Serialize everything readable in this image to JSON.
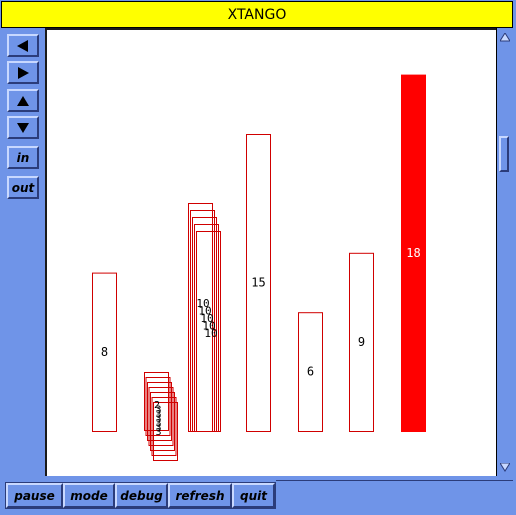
{
  "window": {
    "title": "XTANGO"
  },
  "nav_buttons": [
    {
      "name": "pan-left-button",
      "icon": "arrow-left-icon"
    },
    {
      "name": "pan-right-button",
      "icon": "arrow-right-icon"
    },
    {
      "name": "pan-up-button",
      "icon": "arrow-up-icon"
    },
    {
      "name": "pan-down-button",
      "icon": "arrow-down-icon"
    },
    {
      "name": "zoom-in-button",
      "label": "in"
    },
    {
      "name": "zoom-out-button",
      "label": "out"
    }
  ],
  "controls": [
    "pause",
    "mode",
    "debug",
    "refresh",
    "quit"
  ],
  "colors": {
    "background": "#6f94e8",
    "title_bar": "#ffff00",
    "outline": "#d00000",
    "highlight": "#ff0000"
  },
  "animation": {
    "bars": [
      {
        "label": "8",
        "value": 8,
        "filled": false
      },
      {
        "label": "15",
        "value": 15,
        "filled": false
      },
      {
        "label": "6",
        "value": 6,
        "filled": false
      },
      {
        "label": "9",
        "value": 9,
        "filled": false
      },
      {
        "label": "18",
        "value": 18,
        "filled": true
      }
    ],
    "stack_small": {
      "labels": [
        "2",
        "3",
        "3",
        "3",
        "3",
        "3",
        "3"
      ]
    },
    "stack_tall": {
      "labels": [
        "10",
        "10",
        "10",
        "10",
        "10"
      ]
    }
  }
}
